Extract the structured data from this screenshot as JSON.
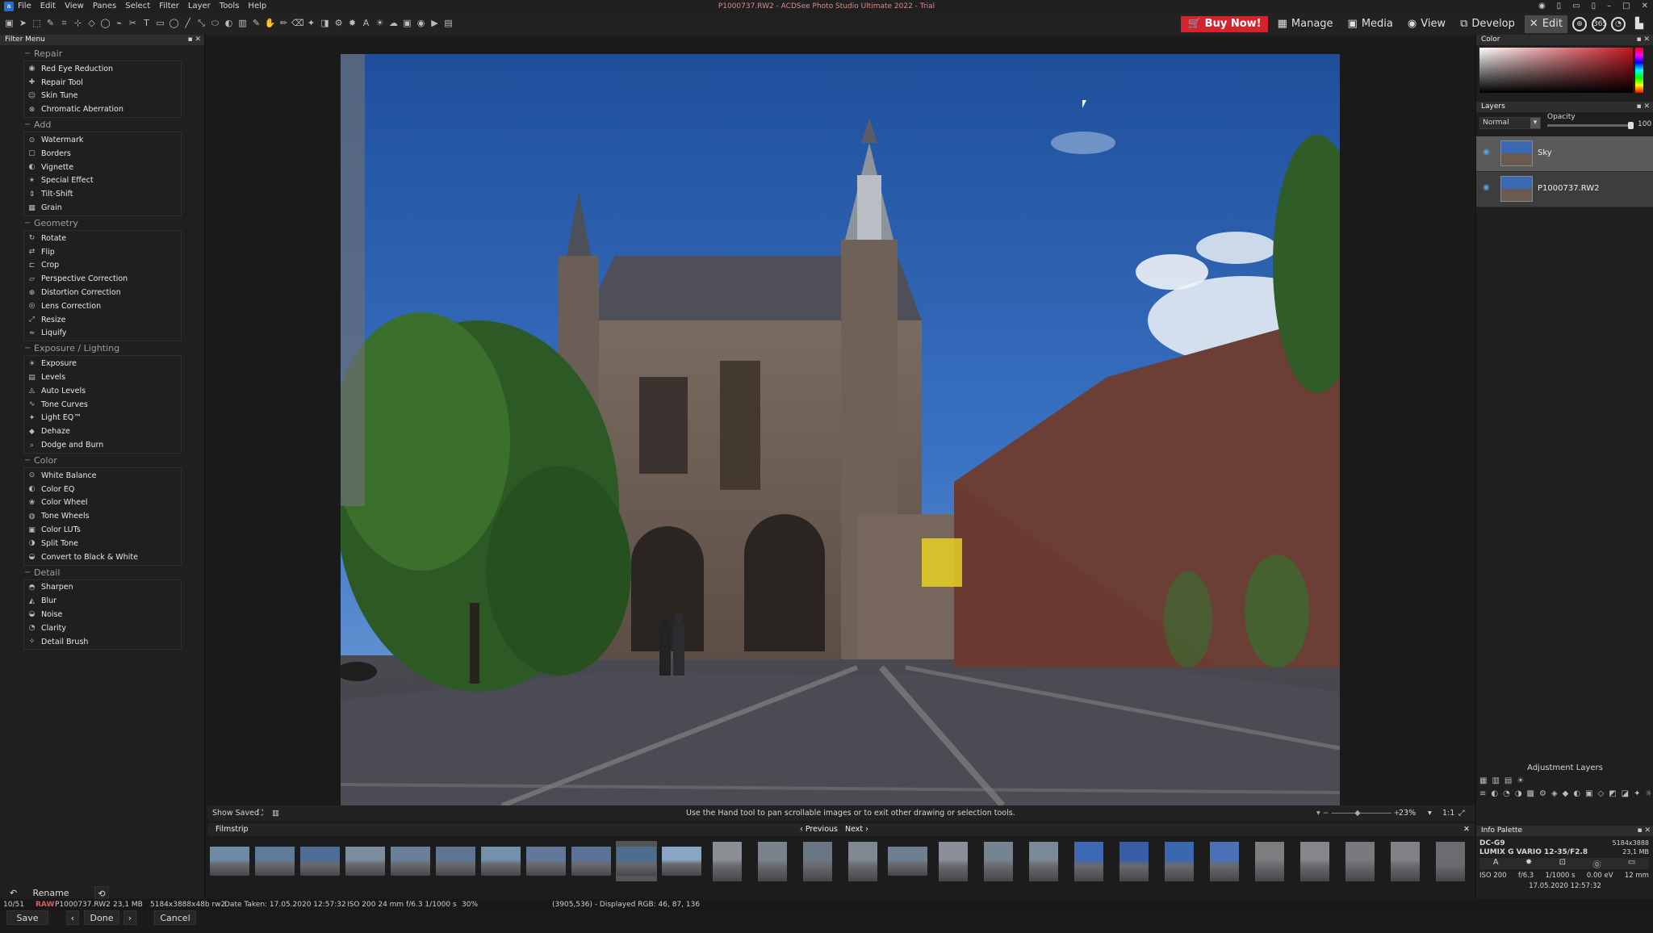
{
  "window": {
    "title": "P1000737.RW2 - ACDSee Photo Studio Ultimate 2022 - Trial",
    "controls": [
      "–",
      "□",
      "✕"
    ]
  },
  "menu": [
    "File",
    "Edit",
    "View",
    "Panes",
    "Select",
    "Filter",
    "Layer",
    "Tools",
    "Help"
  ],
  "modes": {
    "buy": "Buy Now!",
    "items": [
      {
        "label": "Manage",
        "icon": "grid-icon"
      },
      {
        "label": "Media",
        "icon": "media-icon"
      },
      {
        "label": "View",
        "icon": "eye-icon"
      },
      {
        "label": "Develop",
        "icon": "develop-icon"
      },
      {
        "label": "Edit",
        "icon": "edit-icon",
        "active": true
      }
    ]
  },
  "filter_menu": {
    "title": "Filter Menu",
    "sections": [
      {
        "title": "Repair",
        "items": [
          "Red Eye Reduction",
          "Repair Tool",
          "Skin Tune",
          "Chromatic Aberration"
        ]
      },
      {
        "title": "Add",
        "items": [
          "Watermark",
          "Borders",
          "Vignette",
          "Special Effect",
          "Tilt-Shift",
          "Grain"
        ]
      },
      {
        "title": "Geometry",
        "items": [
          "Rotate",
          "Flip",
          "Crop",
          "Perspective Correction",
          "Distortion Correction",
          "Lens Correction",
          "Resize",
          "Liquify"
        ]
      },
      {
        "title": "Exposure / Lighting",
        "items": [
          "Exposure",
          "Levels",
          "Auto Levels",
          "Tone Curves",
          "Light EQ™",
          "Dehaze",
          "Dodge and Burn"
        ]
      },
      {
        "title": "Color",
        "items": [
          "White Balance",
          "Color EQ",
          "Color Wheel",
          "Tone Wheels",
          "Color LUTs",
          "Split Tone",
          "Convert to Black & White"
        ]
      },
      {
        "title": "Detail",
        "items": [
          "Sharpen",
          "Blur",
          "Noise",
          "Clarity",
          "Detail Brush"
        ]
      }
    ]
  },
  "buttons": {
    "rename": "Rename",
    "save": "Save",
    "done": "Done",
    "cancel": "Cancel"
  },
  "canvas_status": {
    "show_saved": "Show Saved",
    "hint": "Use the Hand tool to pan scrollable images or to exit other drawing or selection tools.",
    "zoom": "23%",
    "ratio": "1:1"
  },
  "filmstrip": {
    "title": "Filmstrip",
    "previous": "Previous",
    "next": "Next",
    "thumb_count": 28,
    "selected_index": 9
  },
  "color_panel": {
    "title": "Color"
  },
  "layers": {
    "title": "Layers",
    "blend": "Normal",
    "opacity_label": "Opacity",
    "opacity_value": "100",
    "items": [
      {
        "name": "Sky"
      },
      {
        "name": "P1000737.RW2"
      }
    ]
  },
  "adjustment_layers": {
    "title": "Adjustment Layers"
  },
  "info": {
    "title": "Info Palette",
    "camera": "DC-G9",
    "lens": "LUMIX G VARIO 12-35/F2.8",
    "dims": "5184x3888",
    "size": "23,1 MB",
    "iso": "ISO 200",
    "aperture": "f/6.3",
    "shutter": "1/1000 s",
    "ev": "0.00 eV",
    "focal": "12 mm",
    "date": "17.05.2020 12:57:32",
    "mode": "A"
  },
  "statusbar": {
    "index": "10/51",
    "type": "RAW",
    "file": "P1000737.RW2",
    "size": "23,1 MB",
    "dims": "5184x3888x48b rw2",
    "date": "Date Taken: 17.05.2020 12:57:32",
    "exif": "ISO 200   24 mm   f/6.3   1/1000 s",
    "zoom": "30%",
    "pixel": "(3905,536) - Displayed RGB: 46, 87, 136"
  }
}
